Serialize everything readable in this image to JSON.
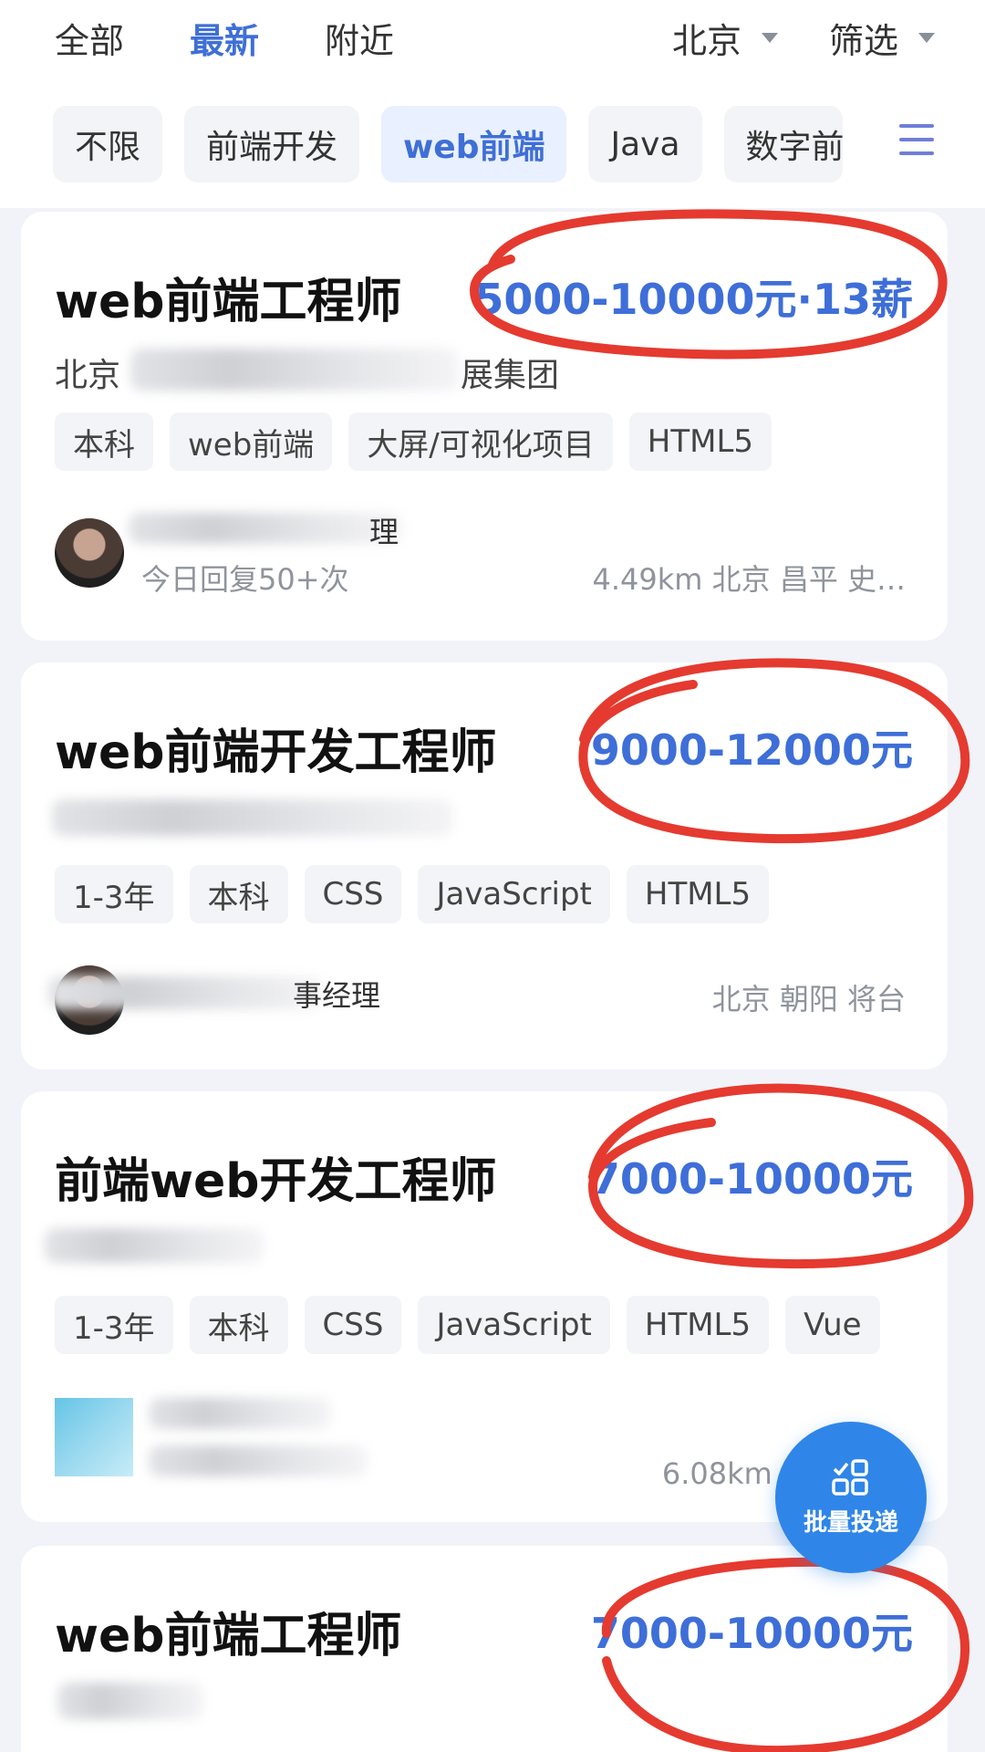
{
  "top_tabs": [
    {
      "label": "全部",
      "active": false
    },
    {
      "label": "最新",
      "active": true
    },
    {
      "label": "附近",
      "active": false
    }
  ],
  "top_right": {
    "city": "北京",
    "filter": "筛选"
  },
  "chips": [
    {
      "label": "不限",
      "active": false
    },
    {
      "label": "前端开发",
      "active": false
    },
    {
      "label": "web前端",
      "active": true
    },
    {
      "label": "Java",
      "active": false
    },
    {
      "label": "数字前",
      "active": false
    }
  ],
  "jobs": [
    {
      "title": "web前端工程师",
      "salary": "5000-10000元·13薪",
      "company_visible": "北京",
      "company_tail": "展集团",
      "tags": [
        "本科",
        "web前端",
        "大屏/可视化项目",
        "HTML5"
      ],
      "recruiter_tail": "理",
      "reply": "今日回复50+次",
      "location": "4.49km 北京 昌平 史…"
    },
    {
      "title": "web前端开发工程师",
      "salary": "9000-12000元",
      "tags": [
        "1-3年",
        "本科",
        "CSS",
        "JavaScript",
        "HTML5"
      ],
      "recruiter_tail": "事经理",
      "location": "北京 朝阳 将台"
    },
    {
      "title": "前端web开发工程师",
      "salary": "7000-10000元",
      "tags": [
        "1-3年",
        "本科",
        "CSS",
        "JavaScript",
        "HTML5",
        "Vue"
      ],
      "location": "6.08km 北"
    },
    {
      "title": "web前端工程师",
      "salary": "7000-10000元"
    }
  ],
  "fab": {
    "label": "批量投递",
    "icon": "batch-apply-icon"
  },
  "colors": {
    "accent": "#3e6ed8",
    "marker": "#e53a2f",
    "fab": "#2f86e8"
  }
}
